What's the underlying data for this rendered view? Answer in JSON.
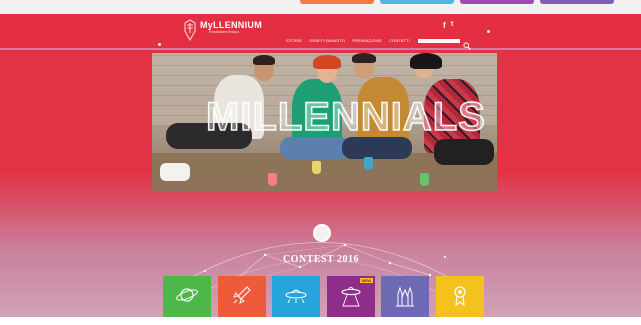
{
  "browser": {
    "tabs": [
      {
        "color": "#f47a3f"
      },
      {
        "color": "#52b6df"
      },
      {
        "color": "#9f4ab2"
      },
      {
        "color": "#7f5fb5"
      }
    ]
  },
  "header": {
    "logo_text": "MyLLENNIUM",
    "logo_tagline": "Fondazione Bracco",
    "social": {
      "facebook": "f",
      "twitter": "t"
    },
    "nav": [
      "STORIE",
      "GRAFFI BANDITO",
      "PREMIAZIONE",
      "CONTATTI"
    ],
    "search": {
      "placeholder": ""
    }
  },
  "hero": {
    "title": "MILLENNIALS"
  },
  "contest": {
    "title": "CONTEST 2016"
  },
  "categories": [
    {
      "icon": "planet-icon",
      "color": "#4db849"
    },
    {
      "icon": "rocket-icon",
      "color": "#ee5b3b"
    },
    {
      "icon": "ufo-icon",
      "color": "#27a4d9"
    },
    {
      "icon": "ufo-beam-icon",
      "color": "#8f2d8c",
      "badge": "NEW"
    },
    {
      "icon": "cathedral-icon",
      "color": "#6e69b3"
    },
    {
      "icon": "award-icon",
      "color": "#f4c21f"
    }
  ],
  "colors": {
    "brand_red": "#e23345",
    "header_red": "#e32f41"
  }
}
